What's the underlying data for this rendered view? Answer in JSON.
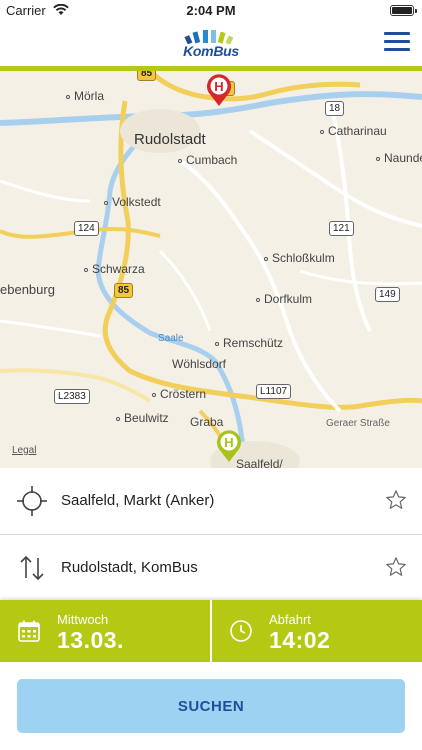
{
  "status_bar": {
    "carrier": "Carrier",
    "time": "2:04 PM"
  },
  "app": {
    "logo_text": "KomBus",
    "menu_icon": "hamburger-menu-icon",
    "brand_blue": "#1f4f9a",
    "brand_green": "#b5c814"
  },
  "map": {
    "legal": "Legal",
    "places": [
      {
        "name": "Mörla",
        "dot": true
      },
      {
        "name": "Rudolstadt",
        "dot": false
      },
      {
        "name": "Cumbach",
        "dot": true
      },
      {
        "name": "Catharinau",
        "dot": true
      },
      {
        "name": "Naunde",
        "dot": true
      },
      {
        "name": "Volkstedt",
        "dot": true
      },
      {
        "name": "Schloßkulm",
        "dot": true
      },
      {
        "name": "Schwarza",
        "dot": true
      },
      {
        "name": "ebenburg",
        "dot": false
      },
      {
        "name": "Dorfkulm",
        "dot": true
      },
      {
        "name": "Remschütz",
        "dot": true
      },
      {
        "name": "Wöhlsdorf",
        "dot": true
      },
      {
        "name": "Cröstern",
        "dot": true
      },
      {
        "name": "Beulwitz",
        "dot": true
      },
      {
        "name": "Graba",
        "dot": true
      },
      {
        "name": "Saalfeld/",
        "dot": false
      }
    ],
    "river": "Saale",
    "street": "Geraer Straße",
    "road_shields": [
      "85",
      "88",
      "18",
      "124",
      "121",
      "85",
      "149",
      "L2383",
      "L1107"
    ]
  },
  "route": {
    "from": "Saalfeld, Markt (Anker)",
    "to": "Rudolstadt, KomBus"
  },
  "datetime": {
    "day_label": "Mittwoch",
    "date": "13.03.",
    "mode_label": "Abfahrt",
    "time": "14:02"
  },
  "search_label": "SUCHEN"
}
